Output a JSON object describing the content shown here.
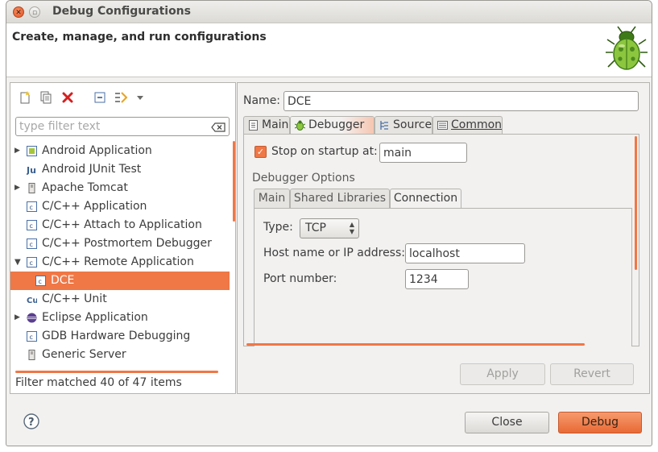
{
  "window": {
    "title": "Debug Configurations"
  },
  "banner": {
    "heading": "Create, manage, and run configurations"
  },
  "left": {
    "toolbar": [
      "new-launch-configuration-icon",
      "duplicate-icon",
      "delete-icon",
      "collapse-all-icon",
      "filter-icon",
      "dropdown-arrow-icon"
    ],
    "filter_placeholder": "type filter text",
    "tree": [
      {
        "label": "Android Application",
        "expandable": true,
        "icon": "android-app-icon"
      },
      {
        "label": "Android JUnit Test",
        "expandable": false,
        "icon": "junit-icon"
      },
      {
        "label": "Apache Tomcat",
        "expandable": true,
        "icon": "server-icon"
      },
      {
        "label": "C/C++ Application",
        "expandable": false,
        "icon": "c-app-icon"
      },
      {
        "label": "C/C++ Attach to Application",
        "expandable": false,
        "icon": "c-app-icon"
      },
      {
        "label": "C/C++ Postmortem Debugger",
        "expandable": false,
        "icon": "c-app-icon"
      },
      {
        "label": "C/C++ Remote Application",
        "expandable": true,
        "expanded": true,
        "icon": "c-app-icon"
      },
      {
        "label": "DCE",
        "child": true,
        "selected": true,
        "icon": "c-app-icon"
      },
      {
        "label": "C/C++ Unit",
        "expandable": false,
        "icon": "c-unit-icon"
      },
      {
        "label": "Eclipse Application",
        "expandable": true,
        "icon": "eclipse-icon"
      },
      {
        "label": "GDB Hardware Debugging",
        "expandable": false,
        "icon": "c-app-icon"
      },
      {
        "label": "Generic Server",
        "expandable": false,
        "icon": "server-icon"
      }
    ],
    "status": "Filter matched 40 of 47 items"
  },
  "right": {
    "name_label": "Name:",
    "name_value": "DCE",
    "tabs": [
      {
        "label": "Main",
        "icon": "main-tab-icon"
      },
      {
        "label": "Debugger",
        "icon": "bug-icon",
        "active": true
      },
      {
        "label": "Source",
        "icon": "source-icon"
      },
      {
        "label": "Common",
        "icon": "common-icon"
      }
    ],
    "stop_on_startup": {
      "label": "Stop on startup at:",
      "checked": true,
      "value": "main"
    },
    "debugger_options_label": "Debugger Options",
    "subtabs": [
      {
        "label": "Main"
      },
      {
        "label": "Shared Libraries"
      },
      {
        "label": "Connection",
        "active": true
      }
    ],
    "connection": {
      "type_label": "Type:",
      "type_value": "TCP",
      "host_label": "Host name or IP address:",
      "host_value": "localhost",
      "port_label": "Port number:",
      "port_value": "1234"
    },
    "apply_label": "Apply",
    "revert_label": "Revert"
  },
  "footer": {
    "close_label": "Close",
    "debug_label": "Debug"
  },
  "colors": {
    "accent": "#f07746",
    "window_bg": "#f2f1f0"
  }
}
